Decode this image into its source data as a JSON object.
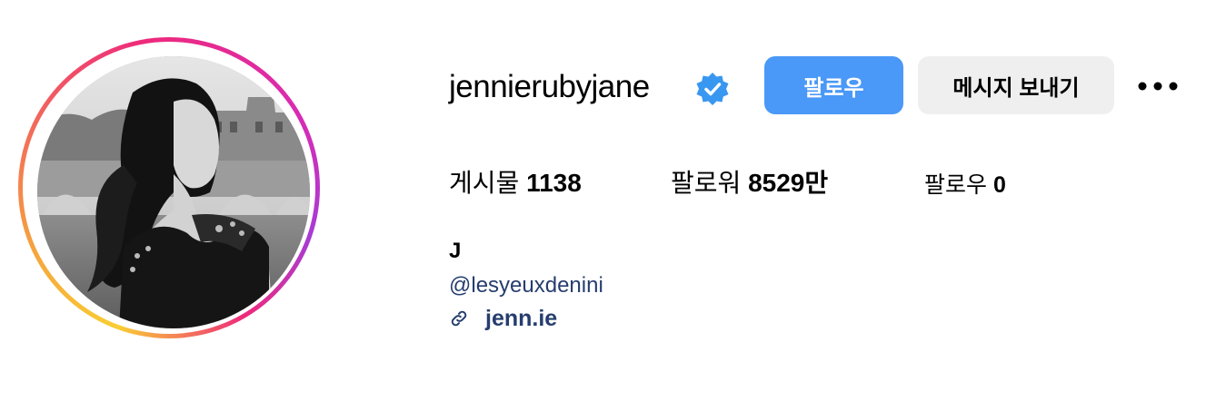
{
  "profile": {
    "username": "jennierubyjane",
    "verified": true,
    "avatar_alt": "jennierubyjane profile picture"
  },
  "actions": {
    "follow_label": "팔로우",
    "message_label": "메시지 보내기",
    "more_icon": "more-horizontal-icon"
  },
  "stats": {
    "posts_label": "게시물",
    "posts_value": "1138",
    "followers_label": "팔로워",
    "followers_value": "8529만",
    "following_label": "팔로우",
    "following_value": "0"
  },
  "bio": {
    "name": "J",
    "mention": "@lesyeuxdenini",
    "link_text": "jenn.ie",
    "link_icon": "link-icon"
  },
  "colors": {
    "follow_button_bg": "#4a98f7",
    "message_button_bg": "#efefef",
    "verified_badge": "#3897f0",
    "link_text": "#263d6e"
  }
}
